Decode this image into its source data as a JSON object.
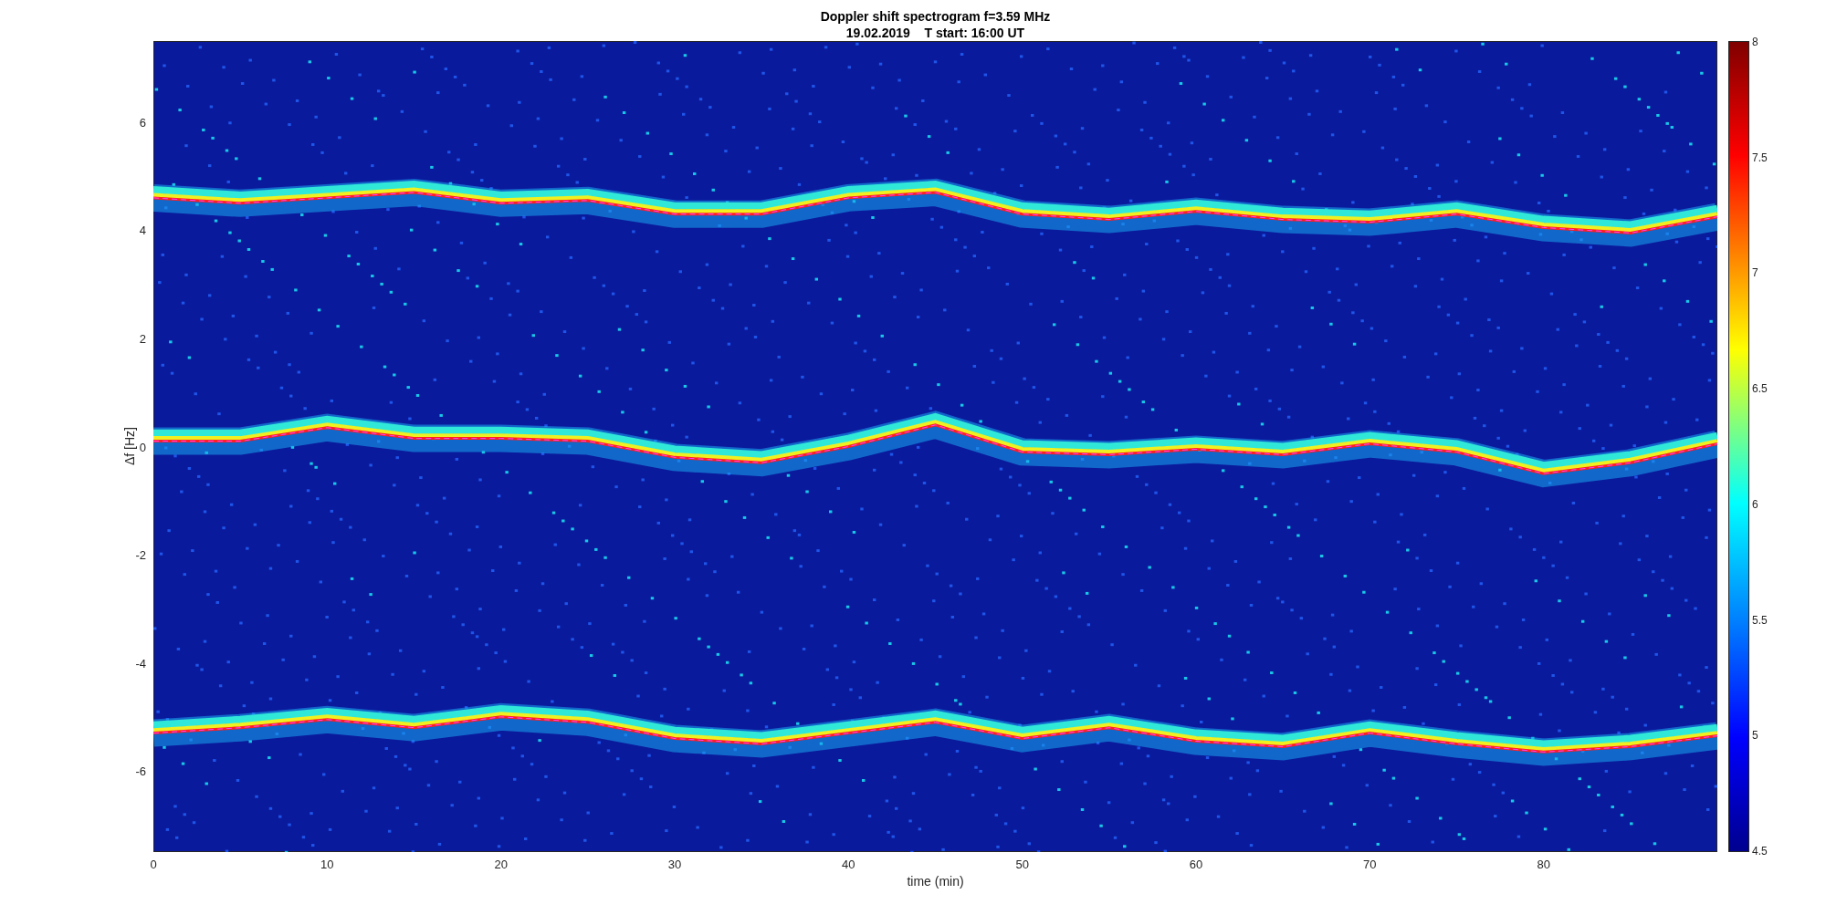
{
  "figure": {
    "title": "Doppler shift spectrogram f=3.59 MHz",
    "subtitle": "19.02.2019    T start: 16:00 UT"
  },
  "axes": {
    "xlabel": "time (min)",
    "ylabel": "Δf [Hz]",
    "xtick_labels": [
      "0",
      "10",
      "20",
      "30",
      "40",
      "50",
      "60",
      "70",
      "80"
    ],
    "ytick_labels": [
      "6",
      "4",
      "2",
      "0",
      "-2",
      "-4",
      "-6"
    ]
  },
  "colorbar": {
    "tick_labels": [
      "8",
      "7.5",
      "7",
      "6.5",
      "6",
      "5.5",
      "5",
      "4.5"
    ]
  }
}
